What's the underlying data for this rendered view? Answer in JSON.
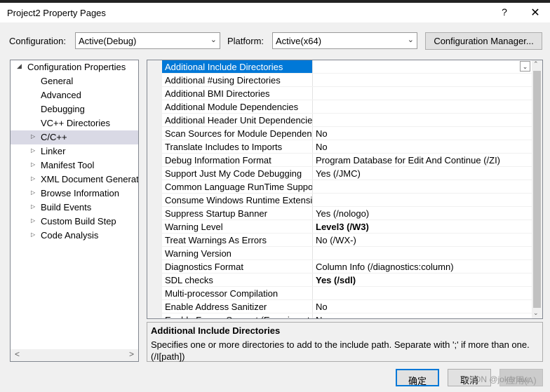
{
  "window": {
    "title": "Project2 Property Pages",
    "help_glyph": "?",
    "close_glyph": "✕"
  },
  "config": {
    "configuration_label": "Configuration:",
    "configuration_value": "Active(Debug)",
    "platform_label": "Platform:",
    "platform_value": "Active(x64)",
    "manager_button": "Configuration Manager..."
  },
  "tree": {
    "root": "Configuration Properties",
    "items": [
      "General",
      "Advanced",
      "Debugging",
      "VC++ Directories",
      "C/C++",
      "Linker",
      "Manifest Tool",
      "XML Document Generat",
      "Browse Information",
      "Build Events",
      "Custom Build Step",
      "Code Analysis"
    ],
    "selected": "C/C++"
  },
  "grid": {
    "rows": [
      {
        "name": "Additional Include Directories",
        "value": ""
      },
      {
        "name": "Additional #using Directories",
        "value": ""
      },
      {
        "name": "Additional BMI Directories",
        "value": ""
      },
      {
        "name": "Additional Module Dependencies",
        "value": ""
      },
      {
        "name": "Additional Header Unit Dependencies",
        "value": ""
      },
      {
        "name": "Scan Sources for Module Dependencies",
        "value": "No"
      },
      {
        "name": "Translate Includes to Imports",
        "value": "No"
      },
      {
        "name": "Debug Information Format",
        "value": "Program Database for Edit And Continue (/ZI)"
      },
      {
        "name": "Support Just My Code Debugging",
        "value": "Yes (/JMC)"
      },
      {
        "name": "Common Language RunTime Support",
        "value": ""
      },
      {
        "name": "Consume Windows Runtime Extension",
        "value": ""
      },
      {
        "name": "Suppress Startup Banner",
        "value": "Yes (/nologo)"
      },
      {
        "name": "Warning Level",
        "value": "Level3 (/W3)"
      },
      {
        "name": "Treat Warnings As Errors",
        "value": "No (/WX-)"
      },
      {
        "name": "Warning Version",
        "value": ""
      },
      {
        "name": "Diagnostics Format",
        "value": "Column Info (/diagnostics:column)"
      },
      {
        "name": "SDL checks",
        "value": "Yes (/sdl)"
      },
      {
        "name": "Multi-processor Compilation",
        "value": ""
      },
      {
        "name": "Enable Address Sanitizer",
        "value": "No"
      },
      {
        "name": "Enable Fuzzer Support (Experimental)",
        "value": "No"
      }
    ],
    "selected": "Additional Include Directories"
  },
  "description": {
    "title": "Additional Include Directories",
    "text": "Specifies one or more directories to add to the include path. Separate with ';' if more than one.     (/I[path])"
  },
  "buttons": {
    "ok": "确定",
    "cancel": "取消",
    "apply": "应用(A)"
  },
  "watermark": "CSDN @jokerlaw"
}
